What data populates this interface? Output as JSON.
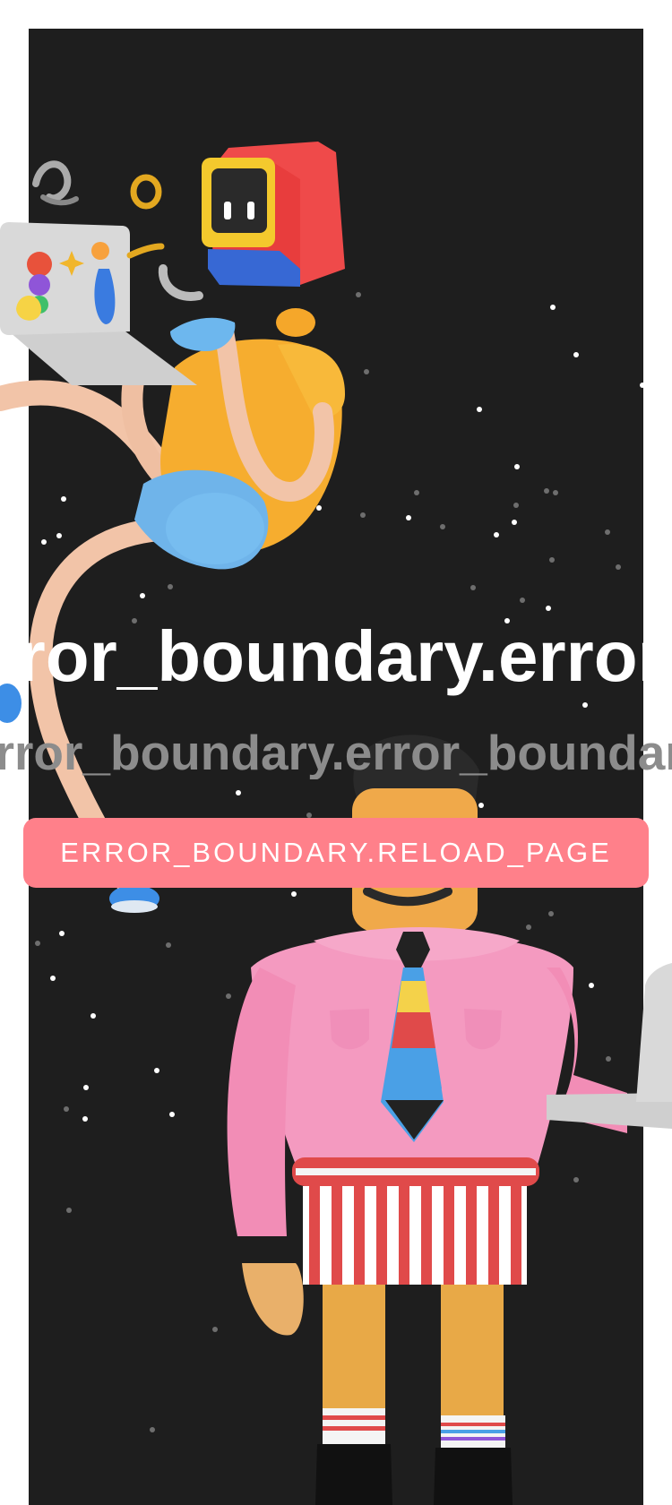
{
  "error_boundary": {
    "title": "error_boundary.error_boundary.title",
    "subtitle": "error_boundary.error_boundary.subtitle",
    "reload_label": "ERROR_BOUNDARY.RELOAD_PAGE"
  },
  "colors": {
    "panel_background": "#1e1e1e",
    "title": "#ffffff",
    "subtitle": "#8c8c8c",
    "button_background": "#ff808a",
    "button_text": "#ffffff"
  },
  "illustrations": {
    "top": "floating-computer-head-character-with-laptop",
    "bottom": "standing-man-in-pink-shirt-with-laptop"
  }
}
